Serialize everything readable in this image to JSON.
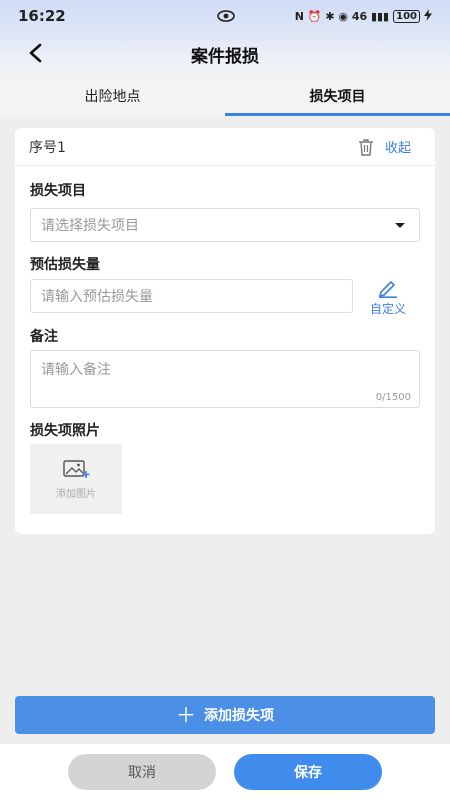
{
  "status_bar": {
    "time": "16:22",
    "center_icon": "eye-icon",
    "right_text": "N ⏰ ✱ ◉ 46 ▮▮▮",
    "battery": "100",
    "charging_icon": "bolt-icon"
  },
  "navbar": {
    "title": "案件报损",
    "back_icon": "chevron-left-icon"
  },
  "tabs": [
    {
      "label": "出险地点",
      "active": false
    },
    {
      "label": "损失项目",
      "active": true
    }
  ],
  "item": {
    "seq_label": "序号1",
    "delete_icon": "trash-icon",
    "collapse_label": "收起",
    "loss_item": {
      "label": "损失项目",
      "placeholder": "请选择损失项目"
    },
    "estimated_loss": {
      "label": "预估损失量",
      "placeholder": "请输入预估损失量",
      "custom_label": "自定义"
    },
    "remark": {
      "label": "备注",
      "placeholder": "请输入备注",
      "counter": "0/1500"
    },
    "photos": {
      "label": "损失项照片",
      "add_label": "添加图片"
    }
  },
  "add_item_button": "添加损失项",
  "footer": {
    "cancel_label": "取消",
    "save_label": "保存"
  },
  "colors": {
    "accent": "#3b82e0",
    "add_button": "#4b8fe6",
    "save_button": "#3f8cec",
    "cancel_button": "#d4d4d4"
  }
}
